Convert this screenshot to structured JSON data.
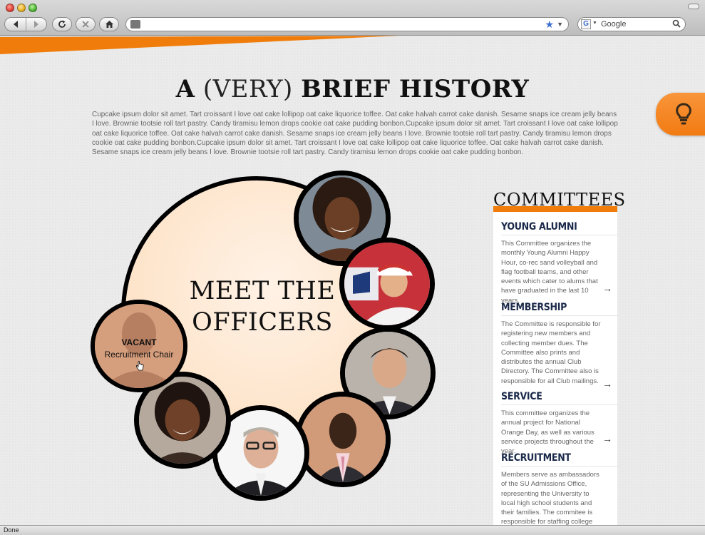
{
  "browser": {
    "search_placeholder": "Google",
    "status": "Done"
  },
  "page": {
    "title_a": "A",
    "title_very": "(VERY)",
    "title_rest": "BRIEF HISTORY",
    "intro": "Cupcake ipsum dolor sit amet. Tart croissant I love oat cake lollipop oat cake liquorice toffee. Oat cake halvah carrot cake danish. Sesame snaps ice cream jelly beans I love. Brownie tootsie roll tart pastry. Candy tiramisu lemon drops cookie oat cake pudding bonbon.Cupcake ipsum dolor sit amet. Tart croissant I love oat cake lollipop oat cake liquorice toffee. Oat cake halvah carrot cake danish. Sesame snaps ice cream jelly beans I love. Brownie tootsie roll tart pastry. Candy tiramisu lemon drops cookie oat cake pudding bonbon.Cupcake ipsum dolor sit amet. Tart croissant I love oat cake lollipop oat cake liquorice toffee. Oat cake halvah carrot cake danish. Sesame snaps ice cream jelly beans I love. Brownie tootsie roll tart pastry. Candy tiramisu lemon drops cookie oat cake pudding bonbon.",
    "accent_color": "#f07d0b"
  },
  "officers": {
    "heading_line1": "MEET THE",
    "heading_line2": "OFFICERS",
    "vacant_title": "VACANT",
    "vacant_role": "Recruitment Chair"
  },
  "committees": {
    "heading": "COMMITTEES",
    "items": [
      {
        "name": "YOUNG ALUMNI",
        "desc": "This Committee organizes the monthly Young Alumni Happy Hour, co-rec sand volleyball and flag football teams, and other events which cater to alums that have graduated in the last 10 years.",
        "arrow": "→"
      },
      {
        "name": "MEMBERSHIP",
        "desc": "The Committee is responsible for registering new members and collecting member dues. The Committee also prints and distributes the annual Club Directory. The Committee also is responsible for all Club mailings.",
        "arrow": "→"
      },
      {
        "name": "SERVICE",
        "desc": "This committee organizes the annual project for National Orange Day, as well as various service projects throughout the year.",
        "arrow": "→"
      },
      {
        "name": "RECRUITMENT",
        "desc": "Members serve as ambassadors of the SU Admissions Office, representing the University to local high school students and their families. The commitee is responsible for staffing college fairs"
      }
    ]
  }
}
